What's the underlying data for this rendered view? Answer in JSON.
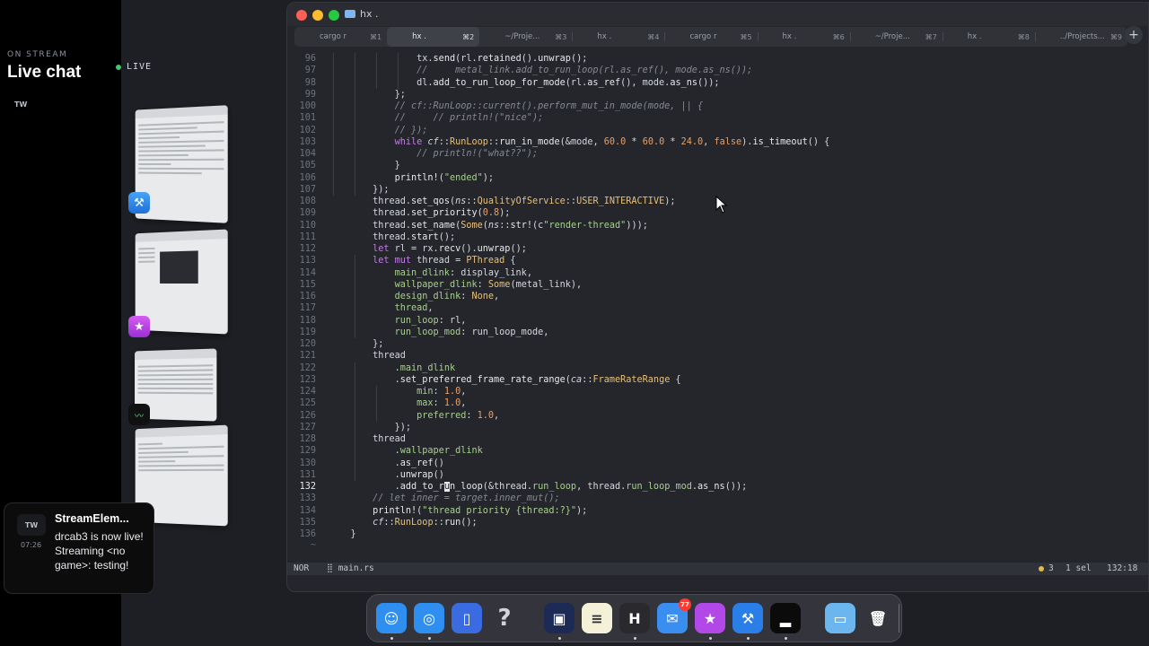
{
  "stream": {
    "on_stream": "ON STREAM",
    "live_chat": "Live chat",
    "live_badge": "LIVE",
    "tw": "TW"
  },
  "notification": {
    "icon": "TW",
    "time": "07:26",
    "title": "StreamElem...",
    "body": "drcab3 is now live! Streaming <no game>: testing!"
  },
  "window": {
    "title": "hx ."
  },
  "tabs": [
    {
      "label": "cargo r",
      "key": "⌘1"
    },
    {
      "label": "hx .",
      "key": "⌘2",
      "active": true
    },
    {
      "label": "~/Proje...",
      "key": "⌘3"
    },
    {
      "label": "hx .",
      "key": "⌘4"
    },
    {
      "label": "cargo r",
      "key": "⌘5"
    },
    {
      "label": "hx .",
      "key": "⌘6"
    },
    {
      "label": "~/Proje...",
      "key": "⌘7"
    },
    {
      "label": "hx .",
      "key": "⌘8"
    },
    {
      "label": "../Projects...",
      "key": "⌘9"
    }
  ],
  "new_tab": "+",
  "code": {
    "lines": [
      {
        "n": "96",
        "html": "                <span class=\"pl\">tx.</span><span class=\"fn\">send</span><span class=\"pl\">(rl.</span><span class=\"fn\">retained</span><span class=\"pl\">().</span><span class=\"fn\">unwrap</span><span class=\"pl\">();</span>"
      },
      {
        "n": "97",
        "html": "                <span class=\"cm\">//     metal_link.add_to_run_loop(rl.as_ref(), mode.as_ns());</span>"
      },
      {
        "n": "98",
        "html": "                <span class=\"pl\">dl.</span><span class=\"fn\">add_to_run_loop_for_mode</span><span class=\"pl\">(rl.</span><span class=\"fn\">as_ref</span><span class=\"pl\">(), mode.</span><span class=\"fn\">as_ns</span><span class=\"pl\">());</span>"
      },
      {
        "n": "99",
        "html": "            <span class=\"pl\">};</span>"
      },
      {
        "n": "100",
        "html": "            <span class=\"cm\">// cf::RunLoop::current().perform_mut_in_mode(mode, || {</span>"
      },
      {
        "n": "101",
        "html": "            <span class=\"cm\">//     // println!(\"nice\");</span>"
      },
      {
        "n": "102",
        "html": "            <span class=\"cm\">// });</span>"
      },
      {
        "n": "103",
        "html": "            <span class=\"kw\">while</span> <span class=\"ns\">cf</span><span class=\"pl\">::</span><span class=\"ty\">RunLoop</span><span class=\"pl\">::</span><span class=\"fn\">run_in_mode</span><span class=\"pl\">(&amp;mode, </span><span class=\"num\">60.0</span><span class=\"pl\"> * </span><span class=\"num\">60.0</span><span class=\"pl\"> * </span><span class=\"num\">24.0</span><span class=\"pl\">, </span><span class=\"num\">false</span><span class=\"pl\">).</span><span class=\"fn\">is_timeout</span><span class=\"pl\">() {</span>"
      },
      {
        "n": "104",
        "html": "                <span class=\"cm\">// println!(\"what??\");</span>"
      },
      {
        "n": "105",
        "html": "            <span class=\"pl\">}</span>"
      },
      {
        "n": "106",
        "html": "            <span class=\"fn\">println!</span><span class=\"pl\">(</span><span class=\"str\">\"ended\"</span><span class=\"pl\">);</span>"
      },
      {
        "n": "107",
        "html": "        <span class=\"pl\">});</span>"
      },
      {
        "n": "108",
        "html": "        <span class=\"pl\">thread.</span><span class=\"fn\">set_qos</span><span class=\"pl\">(</span><span class=\"ns\">ns</span><span class=\"pl\">::</span><span class=\"ty\">QualityOfService</span><span class=\"pl\">::</span><span class=\"ty\">USER_INTERACTIVE</span><span class=\"pl\">);</span>"
      },
      {
        "n": "109",
        "html": "        <span class=\"pl\">thread.</span><span class=\"fn\">set_priority</span><span class=\"pl\">(</span><span class=\"num\">0.8</span><span class=\"pl\">);</span>"
      },
      {
        "n": "110",
        "html": "        <span class=\"pl\">thread.</span><span class=\"fn\">set_name</span><span class=\"pl\">(</span><span class=\"ty\">Some</span><span class=\"pl\">(</span><span class=\"ns\">ns</span><span class=\"pl\">::</span><span class=\"fn\">str!</span><span class=\"pl\">(c</span><span class=\"str\">\"render-thread\"</span><span class=\"pl\">)));</span>"
      },
      {
        "n": "111",
        "html": "        <span class=\"pl\">thread.</span><span class=\"fn\">start</span><span class=\"pl\">();</span>"
      },
      {
        "n": "112",
        "html": "        <span class=\"kw\">let</span><span class=\"pl\"> rl = rx.</span><span class=\"fn\">recv</span><span class=\"pl\">().</span><span class=\"fn\">unwrap</span><span class=\"pl\">();</span>"
      },
      {
        "n": "113",
        "html": "        <span class=\"kw\">let mut</span><span class=\"pl\"> thread = </span><span class=\"ty\">PThread</span><span class=\"pl\"> {</span>"
      },
      {
        "n": "114",
        "html": "            <span class=\"str\">main_dlink</span><span class=\"pl\">: display_link,</span>"
      },
      {
        "n": "115",
        "html": "            <span class=\"str\">wallpaper_dlink</span><span class=\"pl\">: </span><span class=\"ty\">Some</span><span class=\"pl\">(metal_link),</span>"
      },
      {
        "n": "116",
        "html": "            <span class=\"str\">design_dlink</span><span class=\"pl\">: </span><span class=\"ty\">None</span><span class=\"pl\">,</span>"
      },
      {
        "n": "117",
        "html": "            <span class=\"str\">thread</span><span class=\"pl\">,</span>"
      },
      {
        "n": "118",
        "html": "            <span class=\"str\">run_loop</span><span class=\"pl\">: rl,</span>"
      },
      {
        "n": "119",
        "html": "            <span class=\"str\">run_loop_mod</span><span class=\"pl\">: run_loop_mode,</span>"
      },
      {
        "n": "120",
        "html": "        <span class=\"pl\">};</span>"
      },
      {
        "n": "121",
        "html": "        <span class=\"pl\">thread</span>"
      },
      {
        "n": "122",
        "html": "            <span class=\"pl\">.</span><span class=\"str\">main_dlink</span>"
      },
      {
        "n": "123",
        "html": "            <span class=\"pl\">.</span><span class=\"fn\">set_preferred_frame_rate_range</span><span class=\"pl\">(</span><span class=\"ns\">ca</span><span class=\"pl\">::</span><span class=\"ty\">FrameRateRange</span><span class=\"pl\"> {</span>"
      },
      {
        "n": "124",
        "html": "                <span class=\"str\">min</span><span class=\"pl\">: </span><span class=\"num\">1.0</span><span class=\"pl\">,</span>"
      },
      {
        "n": "125",
        "html": "                <span class=\"str\">max</span><span class=\"pl\">: </span><span class=\"num\">1.0</span><span class=\"pl\">,</span>"
      },
      {
        "n": "126",
        "html": "                <span class=\"str\">preferred</span><span class=\"pl\">: </span><span class=\"num\">1.0</span><span class=\"pl\">,</span>"
      },
      {
        "n": "127",
        "html": "            <span class=\"pl\">});</span>"
      },
      {
        "n": "128",
        "html": "        <span class=\"pl\">thread</span>"
      },
      {
        "n": "129",
        "html": "            <span class=\"pl\">.</span><span class=\"str\">wallpaper_dlink</span>"
      },
      {
        "n": "130",
        "html": "            <span class=\"pl\">.</span><span class=\"fn\">as_ref</span><span class=\"pl\">()</span>"
      },
      {
        "n": "131",
        "html": "            <span class=\"pl\">.</span><span class=\"fn\">unwrap</span><span class=\"pl\">()</span>"
      },
      {
        "n": "132",
        "html": "            <span class=\"pl\">.</span><span class=\"fn\">add_to_r<span class=\"cursor\">u</span>n_loop</span><span class=\"pl\">(&amp;thread.</span><span class=\"str\">run_loop</span><span class=\"pl\">, thread.</span><span class=\"str\">run_loop_mod</span><span class=\"pl\">.</span><span class=\"fn\">as_ns</span><span class=\"pl\">());</span>",
        "current": true
      },
      {
        "n": "133",
        "html": "        <span class=\"cm\">// let inner = target.inner_mut();</span>"
      },
      {
        "n": "134",
        "html": "        <span class=\"fn\">println!</span><span class=\"pl\">(</span><span class=\"str\">\"thread priority {thread:?}\"</span><span class=\"pl\">);</span>"
      },
      {
        "n": "135",
        "html": "        <span class=\"ns\">cf</span><span class=\"pl\">::</span><span class=\"ty\">RunLoop</span><span class=\"pl\">::</span><span class=\"fn\">run</span><span class=\"pl\">();</span>"
      },
      {
        "n": "136",
        "html": "    <span class=\"pl\">}</span>"
      }
    ],
    "tilde": "~"
  },
  "status": {
    "mode": "NOR",
    "file_icon": "⣿",
    "file": "main.rs",
    "diagnostics": "3",
    "selections": "1 sel",
    "position": "132:18"
  },
  "dock": {
    "items": [
      {
        "name": "finder-icon",
        "glyph": "☺",
        "color": "#2f8ff0",
        "dot": true
      },
      {
        "name": "safari-icon",
        "glyph": "◎",
        "color": "#2f8ff0",
        "dot": true
      },
      {
        "name": "notes-app-icon",
        "glyph": "▯",
        "color": "#3a6be0",
        "dot": false
      },
      {
        "name": "help-icon",
        "glyph": "?",
        "color": "transparent",
        "dot": false
      },
      {
        "name": "terminal-icon",
        "glyph": "▣",
        "color": "#1c2a55",
        "dot": true
      },
      {
        "name": "notes-icon",
        "glyph": "≡",
        "color": "#f5f1d8",
        "dot": false
      },
      {
        "name": "helix-icon",
        "glyph": "H",
        "color": "#2a2a2e",
        "dot": true
      },
      {
        "name": "mail-icon",
        "glyph": "✉",
        "color": "#3a8ef0",
        "dot": false,
        "badge": "77"
      },
      {
        "name": "star-app-icon",
        "glyph": "★",
        "color": "#b348e8",
        "dot": true
      },
      {
        "name": "xcode-beta-icon",
        "glyph": "⚒",
        "color": "#2a7ee8",
        "dot": true
      },
      {
        "name": "activity-monitor-icon",
        "glyph": "▂",
        "color": "#0b0b0b",
        "dot": true
      },
      {
        "name": "folder-icon",
        "glyph": "▭",
        "color": "#6cb6f0",
        "dot": false
      },
      {
        "name": "trash-icon",
        "glyph": "🗑",
        "color": "transparent",
        "dot": false
      }
    ]
  }
}
